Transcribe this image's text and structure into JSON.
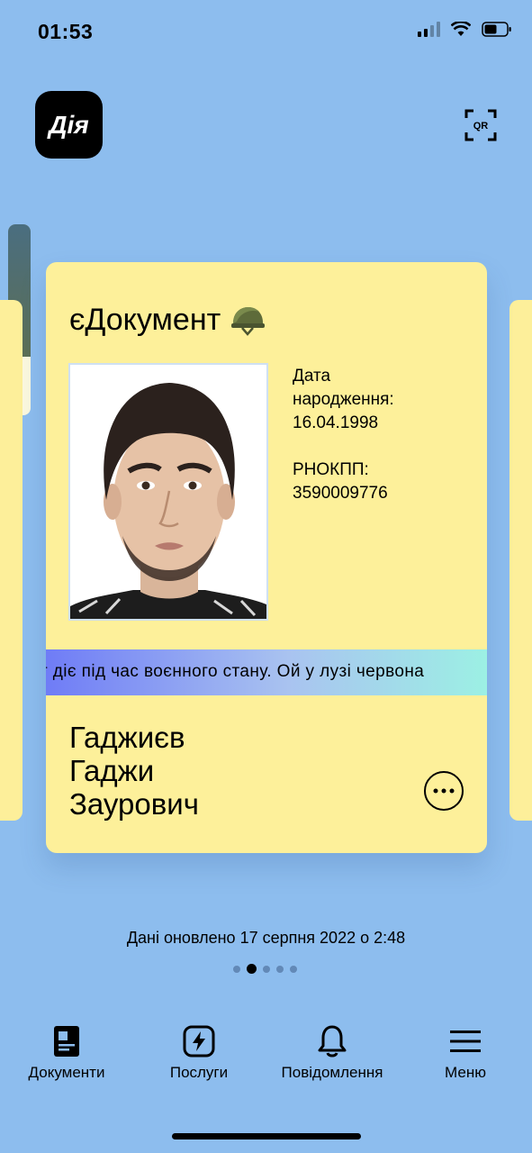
{
  "status_bar": {
    "time": "01:53"
  },
  "header": {
    "logo_text": "Дія",
    "qr_label": "QR"
  },
  "card": {
    "title": "єДокумент",
    "birth_label_line1": "Дата",
    "birth_label_line2": "народження:",
    "birth_date": "16.04.1998",
    "tax_label": "РНОКПП:",
    "tax_number": "3590009776",
    "ticker_text": "т діє під час воєнного стану. Ой у лузі червона",
    "surname": "Гаджиєв",
    "first_name": "Гаджи",
    "patronymic": "Заурович"
  },
  "updated_text": "Дані оновлено 17 серпня 2022 о 2:48",
  "pagination": {
    "total": 5,
    "active": 2
  },
  "tabs": [
    {
      "label": "Документи",
      "icon": "document-icon"
    },
    {
      "label": "Послуги",
      "icon": "lightning-icon"
    },
    {
      "label": "Повідомлення",
      "icon": "bell-icon"
    },
    {
      "label": "Меню",
      "icon": "menu-icon"
    }
  ],
  "colors": {
    "background": "#8dbdee",
    "card": "#fdf09a",
    "ticker_start": "#6f7cf6",
    "ticker_end": "#9cf0e4"
  }
}
